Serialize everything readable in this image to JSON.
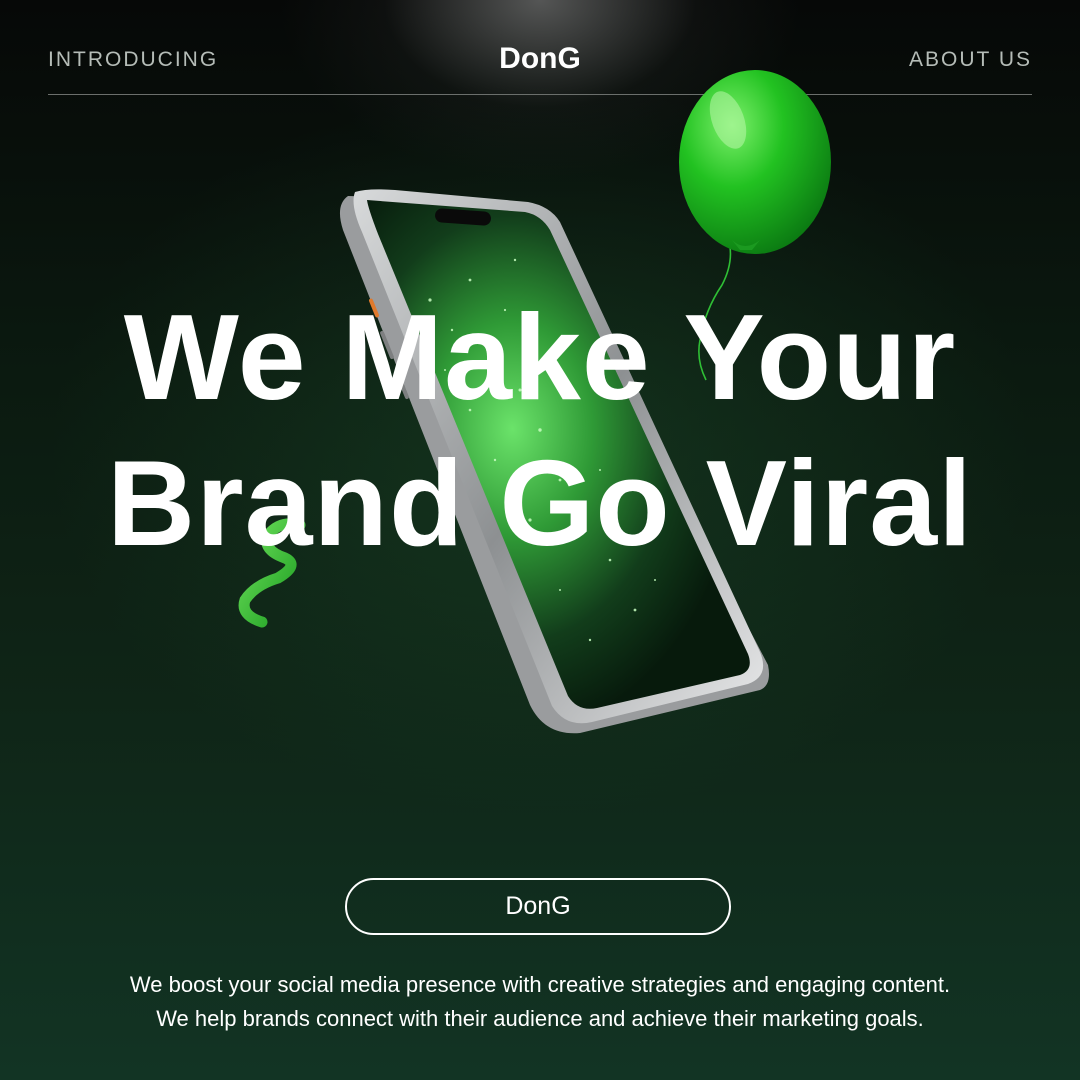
{
  "header": {
    "left_label": "INTRODUCING",
    "brand": "DonG",
    "right_label": "ABOUT US"
  },
  "hero": {
    "headline_line1": "We Make Your",
    "headline_line2": "Brand Go Viral"
  },
  "cta": {
    "label": "DonG"
  },
  "description": {
    "line1": "We boost your social media presence with creative strategies and engaging content.",
    "line2": "We help brands connect with their audience and achieve their marketing goals."
  },
  "colors": {
    "accent_green": "#1fbf2a",
    "background_dark": "#0b1a10",
    "text_white": "#ffffff"
  },
  "icons": [
    "smartphone-illustration",
    "balloon-illustration",
    "ribbon-illustration"
  ]
}
